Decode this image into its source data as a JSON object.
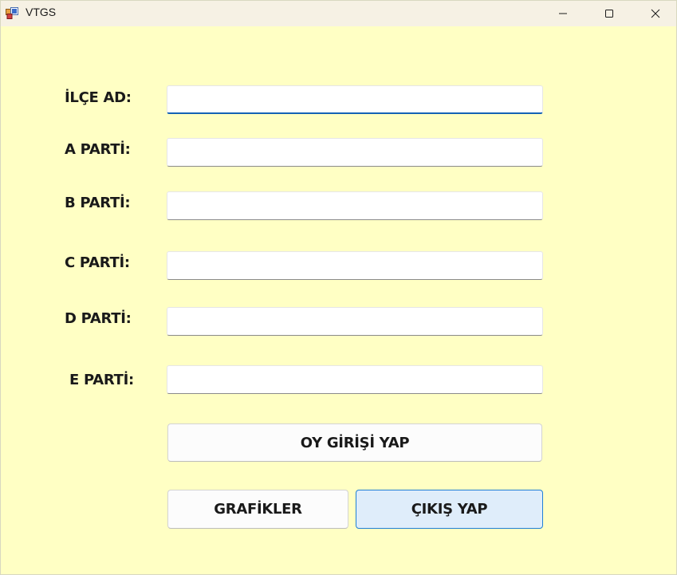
{
  "window": {
    "title": "VTGS"
  },
  "form": {
    "fields": [
      {
        "label": "İLÇE AD:",
        "value": ""
      },
      {
        "label": "A PARTİ:",
        "value": ""
      },
      {
        "label": "B PARTİ:",
        "value": ""
      },
      {
        "label": "C PARTİ:",
        "value": ""
      },
      {
        "label": "D PARTİ:",
        "value": ""
      },
      {
        "label": "E PARTİ:",
        "value": ""
      }
    ]
  },
  "buttons": {
    "submit_vote": "OY GİRİŞİ YAP",
    "charts": "GRAFİKLER",
    "exit": "ÇIKIŞ YAP"
  },
  "colors": {
    "background": "#FFFFC4",
    "titlebar": "#F6F1E4",
    "focus_underline": "#1462B5",
    "exit_button_fill": "#DFEDFA",
    "exit_button_border": "#1F7FD6"
  },
  "icons": {
    "app": "app-icon",
    "minimize": "minimize-icon",
    "maximize": "maximize-icon",
    "close": "close-icon"
  }
}
